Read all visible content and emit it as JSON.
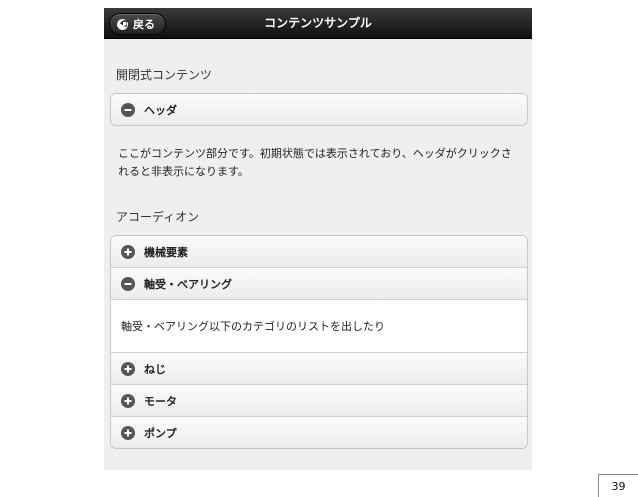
{
  "header": {
    "back_label": "戻る",
    "title": "コンテンツサンプル"
  },
  "collapsible": {
    "section_label": "開閉式コンテンツ",
    "header_label": "ヘッダ",
    "content": "ここがコンテンツ部分です。初期状態では表示されており、ヘッダがクリックされると非表示になります。"
  },
  "accordion": {
    "section_label": "アコーディオン",
    "items": [
      {
        "label": "機械要素",
        "state": "collapsed"
      },
      {
        "label": "軸受・ベアリング",
        "state": "expanded",
        "content": "軸受・ベアリング以下のカテゴリのリストを出したり"
      },
      {
        "label": "ねじ",
        "state": "collapsed"
      },
      {
        "label": "モータ",
        "state": "collapsed"
      },
      {
        "label": "ポンプ",
        "state": "collapsed"
      }
    ]
  },
  "page_number_inner": "39",
  "page_number": "39",
  "icons": {
    "back": "back-arrow-icon",
    "expand": "plus-icon",
    "collapse": "minus-icon"
  },
  "colors": {
    "header_bg": "#1a1a1a",
    "page_bg": "#efefef",
    "icon_bg": "#555555"
  }
}
